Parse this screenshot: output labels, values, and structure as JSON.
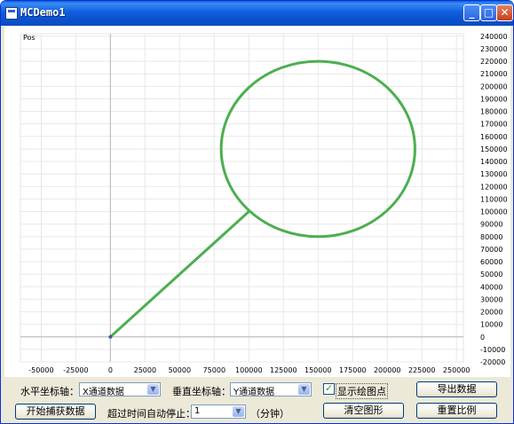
{
  "window": {
    "title": "MCDemo1",
    "controls": {
      "minimize": "_",
      "maximize": "□",
      "close": "✕"
    }
  },
  "chart_data": {
    "type": "line",
    "y_axis_title": "Pos",
    "x_ticks": [
      "-50000",
      "-25000",
      "0",
      "25000",
      "50000",
      "75000",
      "100000",
      "125000",
      "150000",
      "175000",
      "200000",
      "225000",
      "250000"
    ],
    "y_ticks": [
      "240000",
      "230000",
      "220000",
      "210000",
      "200000",
      "190000",
      "180000",
      "170000",
      "160000",
      "150000",
      "140000",
      "130000",
      "120000",
      "110000",
      "100000",
      "90000",
      "80000",
      "70000",
      "60000",
      "50000",
      "40000",
      "30000",
      "20000",
      "10000",
      "0",
      "-10000",
      "-20000"
    ],
    "xlim": [
      -65000,
      255000
    ],
    "ylim": [
      -20000,
      242000
    ],
    "line_color": "#4caf50",
    "series": [
      {
        "x": [
          0,
          100000
        ],
        "y": [
          0,
          100000
        ]
      },
      {
        "circle": {
          "cx": 150000,
          "cy": 150000,
          "r": 70000
        }
      }
    ]
  },
  "form": {
    "x_axis_label": "水平坐标轴：",
    "x_axis_value": "X通道数据",
    "y_axis_label": "垂直坐标轴：",
    "y_axis_value": "Y通道数据",
    "show_points_label": "显示绘图点",
    "show_points_checked": true,
    "export_button": "导出数据",
    "start_button": "开始捕获数据",
    "timeout_label": "超过时间自动停止：",
    "timeout_value": "1",
    "timeout_unit": "（分钟）",
    "clear_button": "清空图形",
    "reset_button": "重置比例"
  }
}
